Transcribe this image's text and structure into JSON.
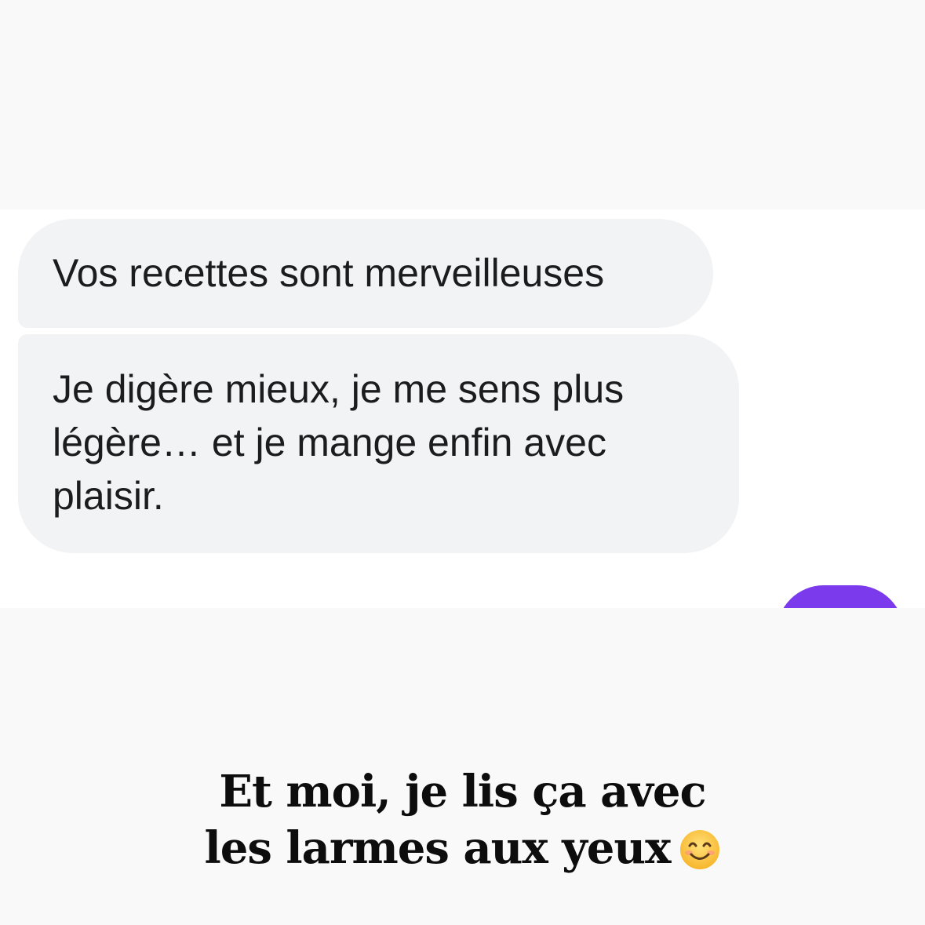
{
  "chat": {
    "messages": [
      {
        "text": "Vos recettes sont merveilleuses"
      },
      {
        "text": "Je digère mieux, je me sens plus légère… et je mange enfin avec plaisir."
      }
    ],
    "outgoing_color": "#7c3aed"
  },
  "caption": {
    "line1": "Et moi, je lis ça avec",
    "line2": "les larmes aux yeux",
    "emoji": "smiling-face-icon"
  }
}
